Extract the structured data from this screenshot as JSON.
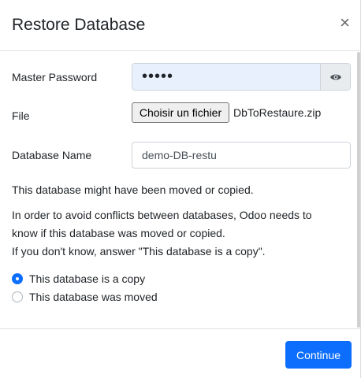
{
  "dialog": {
    "title": "Restore Database",
    "close_glyph": "×"
  },
  "form": {
    "master_password_label": "Master Password",
    "master_password_value": "•••••",
    "file_label": "File",
    "file_button_label": "Choisir un fichier",
    "file_name": "DbToRestaure.zip",
    "database_name_label": "Database Name",
    "database_name_value": "demo-DB-restu"
  },
  "info": {
    "line1": "This database might have been moved or copied.",
    "line2": "In order to avoid conflicts between databases, Odoo needs to",
    "line3": "know if this database was moved or copied.",
    "line4": "If you don't know, answer \"This database is a copy\"."
  },
  "options": [
    {
      "label": "This database is a copy",
      "checked": true
    },
    {
      "label": "This database was moved",
      "checked": false
    }
  ],
  "footer": {
    "continue_label": "Continue"
  },
  "colors": {
    "primary": "#0d6efd",
    "autofill_bg": "#e8f0fe"
  },
  "icons": {
    "password_toggle": "eye-icon",
    "close": "close-icon"
  }
}
